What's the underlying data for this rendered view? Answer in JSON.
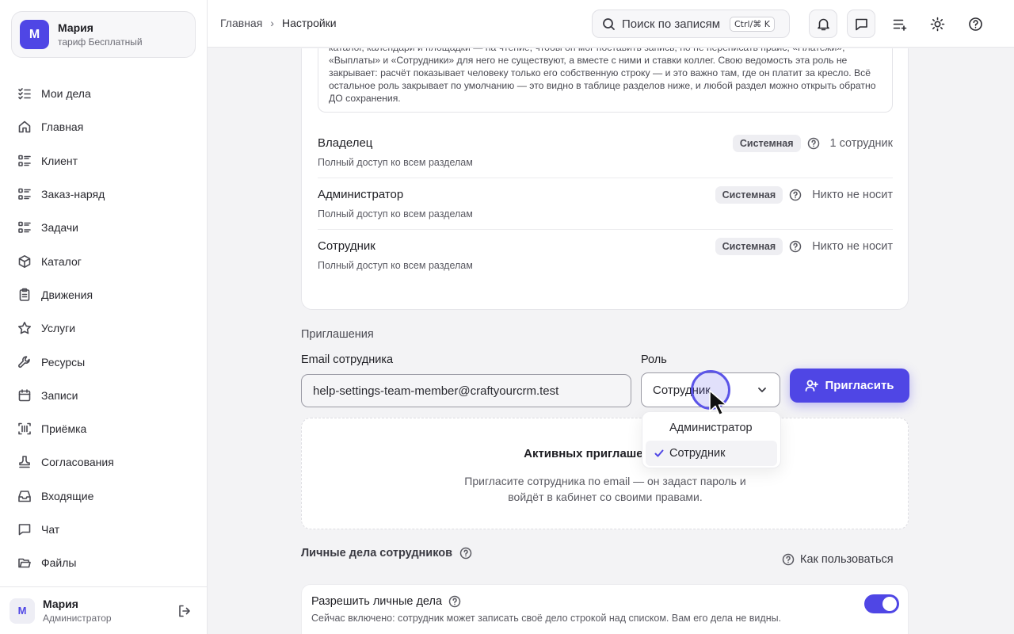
{
  "account": {
    "avatar_letter": "М",
    "name": "Мария",
    "plan": "тариф Бесплатный"
  },
  "sidebar": {
    "items": [
      {
        "label": "Мои дела",
        "icon": "list-check-icon"
      },
      {
        "label": "Главная",
        "icon": "home-icon"
      },
      {
        "label": "Клиент",
        "icon": "list-icon"
      },
      {
        "label": "Заказ-наряд",
        "icon": "list-icon"
      },
      {
        "label": "Задачи",
        "icon": "list-icon"
      },
      {
        "label": "Каталог",
        "icon": "box-icon"
      },
      {
        "label": "Движения",
        "icon": "clipboard-icon"
      },
      {
        "label": "Услуги",
        "icon": "star-icon"
      },
      {
        "label": "Ресурсы",
        "icon": "wrench-icon"
      },
      {
        "label": "Записи",
        "icon": "calendar-icon"
      },
      {
        "label": "Приёмка",
        "icon": "scan-icon"
      },
      {
        "label": "Согласования",
        "icon": "stamp-icon"
      },
      {
        "label": "Входящие",
        "icon": "inbox-icon"
      },
      {
        "label": "Чат",
        "icon": "chat-icon"
      },
      {
        "label": "Файлы",
        "icon": "folder-icon"
      }
    ]
  },
  "user": {
    "avatar_letter": "М",
    "name": "Мария",
    "role": "Администратор"
  },
  "topbar": {
    "breadcrumb": [
      "Главная",
      "Настройки"
    ],
    "search_placeholder": "Поиск по записям и клиентам",
    "search_shortcut": "Ctrl/⌘ K"
  },
  "roles_note": "заказ-наряде, врач на приёме. Записи и заказы — только те, где он стоит ответственным, клиенты — только его, услуги, каталог, календари и площадки — на чтение, чтобы он мог поставить запись, но не переписать прайс; «Платежи», «Выплаты» и «Сотрудники» для него не существуют, а вместе с ними и ставки коллег. Свою ведомость эта роль не закрывает: расчёт показывает человеку только его собственную строку — и это важно там, где он платит за кресло. Всё остальное роль закрывает по умолчанию — это видно в таблице разделов ниже, и любой раздел можно открыть обратно ДО сохранения.",
  "roles": [
    {
      "name": "Владелец",
      "desc": "Полный доступ ко всем разделам",
      "badge": "Системная",
      "holders": "1 сотрудник"
    },
    {
      "name": "Администратор",
      "desc": "Полный доступ ко всем разделам",
      "badge": "Системная",
      "holders": "Никто не носит"
    },
    {
      "name": "Сотрудник",
      "desc": "Полный доступ ко всем разделам",
      "badge": "Системная",
      "holders": "Никто не носит"
    }
  ],
  "invitations": {
    "section_title": "Приглашения",
    "email_label": "Email сотрудника",
    "email_value": "help-settings-team-member@craftyourcrm.test",
    "role_label": "Роль",
    "role_value": "Сотрудник",
    "role_options": [
      "Администратор",
      "Сотрудник"
    ],
    "selected_option": "Сотрудник",
    "invite_button": "Пригласить",
    "empty_title": "Активных приглашений нет",
    "empty_text": "Пригласите сотрудника по email — он задаст пароль и войдёт в кабинет со своими правами."
  },
  "personal": {
    "title": "Личные дела сотрудников",
    "howto": "Как пользоваться",
    "toggle_title": "Разрешить личные дела",
    "toggle_desc": "Сейчас включено: сотрудник может записать своё дело строкой над списком. Вам его дела не видны.",
    "toggle_on": true
  },
  "colors": {
    "accent": "#4f46e5",
    "background": "#f3f3f5"
  }
}
